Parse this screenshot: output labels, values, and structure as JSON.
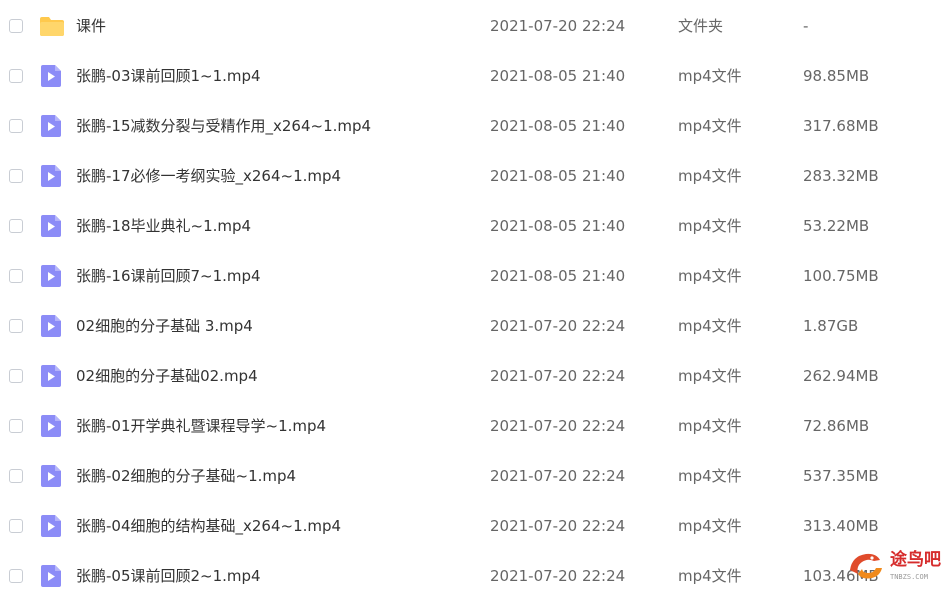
{
  "colors": {
    "folder": "#ffc94d",
    "video_icon": "#8c8cf7",
    "text_primary": "#333333",
    "text_secondary": "#666666",
    "watermark_red": "#d62c2c"
  },
  "files": [
    {
      "icon": "folder-icon",
      "name": "课件",
      "date": "2021-07-20 22:24",
      "type": "文件夹",
      "size": "-"
    },
    {
      "icon": "video-file-icon",
      "name": "张鹏-03课前回顾1~1.mp4",
      "date": "2021-08-05 21:40",
      "type": "mp4文件",
      "size": "98.85MB"
    },
    {
      "icon": "video-file-icon",
      "name": "张鹏-15减数分裂与受精作用_x264~1.mp4",
      "date": "2021-08-05 21:40",
      "type": "mp4文件",
      "size": "317.68MB"
    },
    {
      "icon": "video-file-icon",
      "name": "张鹏-17必修一考纲实验_x264~1.mp4",
      "date": "2021-08-05 21:40",
      "type": "mp4文件",
      "size": "283.32MB"
    },
    {
      "icon": "video-file-icon",
      "name": "张鹏-18毕业典礼~1.mp4",
      "date": "2021-08-05 21:40",
      "type": "mp4文件",
      "size": "53.22MB"
    },
    {
      "icon": "video-file-icon",
      "name": "张鹏-16课前回顾7~1.mp4",
      "date": "2021-08-05 21:40",
      "type": "mp4文件",
      "size": "100.75MB"
    },
    {
      "icon": "video-file-icon",
      "name": "02细胞的分子基础 3.mp4",
      "date": "2021-07-20 22:24",
      "type": "mp4文件",
      "size": "1.87GB"
    },
    {
      "icon": "video-file-icon",
      "name": "02细胞的分子基础02.mp4",
      "date": "2021-07-20 22:24",
      "type": "mp4文件",
      "size": "262.94MB"
    },
    {
      "icon": "video-file-icon",
      "name": "张鹏-01开学典礼暨课程导学~1.mp4",
      "date": "2021-07-20 22:24",
      "type": "mp4文件",
      "size": "72.86MB"
    },
    {
      "icon": "video-file-icon",
      "name": "张鹏-02细胞的分子基础~1.mp4",
      "date": "2021-07-20 22:24",
      "type": "mp4文件",
      "size": "537.35MB"
    },
    {
      "icon": "video-file-icon",
      "name": "张鹏-04细胞的结构基础_x264~1.mp4",
      "date": "2021-07-20 22:24",
      "type": "mp4文件",
      "size": "313.40MB"
    },
    {
      "icon": "video-file-icon",
      "name": "张鹏-05课前回顾2~1.mp4",
      "date": "2021-07-20 22:24",
      "type": "mp4文件",
      "size": "103.46MB"
    }
  ],
  "watermark": {
    "icon": "bird-logo-icon",
    "text": "途鸟吧",
    "sub": "TNBZS.COM"
  }
}
